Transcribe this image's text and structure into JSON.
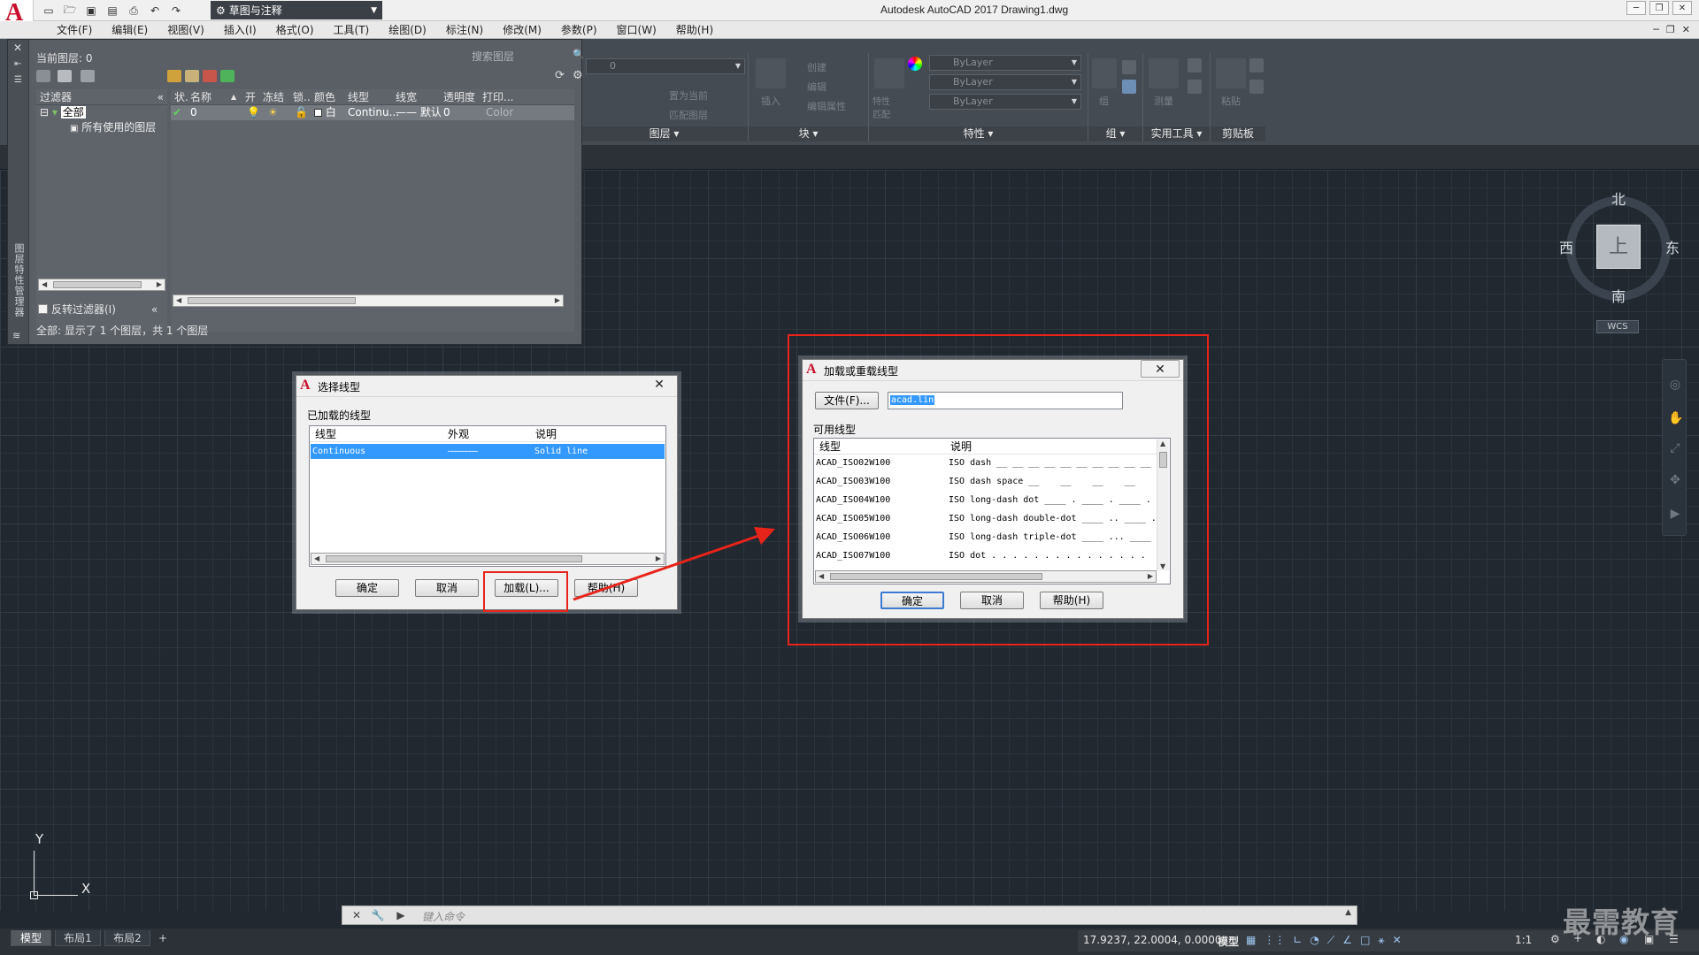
{
  "app": {
    "window_title": "Autodesk AutoCAD 2017    Drawing1.dwg",
    "workspace": "草图与注释"
  },
  "menu": [
    "文件(F)",
    "编辑(E)",
    "视图(V)",
    "插入(I)",
    "格式(O)",
    "工具(T)",
    "绘图(D)",
    "标注(N)",
    "修改(M)",
    "参数(P)",
    "窗口(W)",
    "帮助(H)"
  ],
  "ribbon": {
    "layer_combo": "0",
    "panels": [
      "图层",
      "块",
      "特性",
      "组",
      "实用工具",
      "剪贴板"
    ],
    "block_items": [
      "创建",
      "编辑",
      "编辑属性"
    ],
    "layer_items": [
      "置为当前",
      "匹配图层"
    ],
    "props_combo_1": "ByLayer",
    "props_combo_2": "ByLayer",
    "props_combo_3": "ByLayer",
    "insert_label": "插入",
    "match_label": "特性匹配",
    "group_label": "组",
    "measure_label": "测量",
    "paste_label": "粘贴"
  },
  "layer_palette": {
    "current_layer": "当前图层: 0",
    "search_placeholder": "搜索图层",
    "filters_header": "过滤器",
    "tree_all": "全部",
    "tree_used": "所有使用的图层",
    "invert_filter": "反转过滤器(I)",
    "columns": [
      "状.",
      "名称",
      "开",
      "冻结",
      "锁..",
      "颜色",
      "线型",
      "线宽",
      "透明度",
      "打印..."
    ],
    "row": {
      "name": "0",
      "color": "白",
      "linetype": "Continu...",
      "lineweight": "—— 默认",
      "transparency": "0",
      "plot": "Color"
    },
    "status": "全部: 显示了 1 个图层，共 1 个图层",
    "side_title": "图层特性管理器"
  },
  "viewcube": {
    "north": "北",
    "south": "南",
    "east": "东",
    "west": "西",
    "face": "上",
    "wcs": "WCS"
  },
  "ucs": {
    "x": "X",
    "y": "Y"
  },
  "select_linetype_dialog": {
    "title": "选择线型",
    "loaded_label": "已加载的线型",
    "headers": [
      "线型",
      "外观",
      "说明"
    ],
    "rows": [
      {
        "linetype": "Continuous",
        "appearance": "————————",
        "description": "Solid line"
      }
    ],
    "buttons": {
      "ok": "确定",
      "cancel": "取消",
      "load": "加载(L)...",
      "help": "帮助(H)"
    }
  },
  "load_linetype_dialog": {
    "title": "加载或重载线型",
    "file_button": "文件(F)...",
    "file_value": "acad.lin",
    "available_label": "可用线型",
    "headers": [
      "线型",
      "说明"
    ],
    "rows": [
      {
        "linetype": "ACAD_ISO02W100",
        "description": "ISO dash __ __ __ __ __ __ __ __ __ __"
      },
      {
        "linetype": "ACAD_ISO03W100",
        "description": "ISO dash space __    __    __    __"
      },
      {
        "linetype": "ACAD_ISO04W100",
        "description": "ISO long-dash dot ____ . ____ . ____ ."
      },
      {
        "linetype": "ACAD_ISO05W100",
        "description": "ISO long-dash double-dot ____ .. ____ ."
      },
      {
        "linetype": "ACAD_ISO06W100",
        "description": "ISO long-dash triple-dot ____ ... ____"
      },
      {
        "linetype": "ACAD_ISO07W100",
        "description": "ISO dot . . . . . . . . . . . . . . ."
      }
    ],
    "buttons": {
      "ok": "确定",
      "cancel": "取消",
      "help": "帮助(H)"
    }
  },
  "command_line": {
    "placeholder": "键入命令"
  },
  "layout_tabs": [
    "模型",
    "布局1",
    "布局2",
    "+"
  ],
  "status_bar": {
    "coords": "17.9237, 22.0004, 0.0000",
    "model": "模型",
    "scale": "1:1"
  },
  "watermark": "最需教育",
  "colors": {
    "annotation_red": "#e8231a",
    "selection_blue": "#3399ff",
    "canvas": "#212830"
  }
}
